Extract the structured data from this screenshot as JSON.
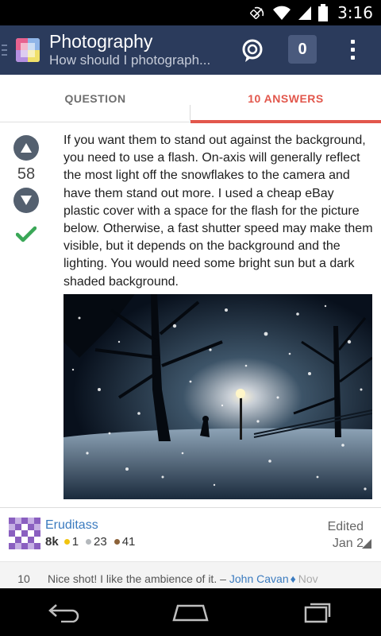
{
  "status_bar": {
    "time": "3:16",
    "icons": [
      "rotation-lock-icon",
      "wifi-icon",
      "signal-icon",
      "battery-icon"
    ]
  },
  "header": {
    "site_name": "Photography",
    "question_title": "How should I photograph...",
    "reputation_badge": "0",
    "colors": {
      "bar": "#2b3b5c",
      "badge": "#4a5a7d"
    }
  },
  "tabs": [
    {
      "label": "QUESTION",
      "active": false
    },
    {
      "label": "10 ANSWERS",
      "active": true
    }
  ],
  "answer": {
    "score": "58",
    "accepted": true,
    "body": "If you want them to stand out against the background, you need to use a flash. On-axis will generally reflect the most light off the snowflakes to the camera and have them stand out more. I used a cheap eBay plastic cover with a space for the flash for the picture below. Otherwise, a fast shutter speed may make them visible, but it depends on the background and the lighting. You would need some bright sun but a dark shaded background.",
    "image_alt": "snowy night park photo"
  },
  "author": {
    "name": "Eruditass",
    "reputation": "8k",
    "gold": "1",
    "silver": "23",
    "bronze": "41",
    "edited_label": "Edited",
    "edited_date": "Jan 2",
    "colors": {
      "gold": "#f1c40f",
      "silver": "#b4b8bc",
      "bronze": "#8c6239"
    }
  },
  "comment": {
    "score": "10",
    "text": "Nice shot! I like the ambience of it. –",
    "user": "John Cavan",
    "moderator_mark": "♦",
    "date": "Nov"
  },
  "accent": {
    "answers_tab": "#e2574c",
    "link": "#3b7bbf",
    "accepted": "#3aa757"
  }
}
